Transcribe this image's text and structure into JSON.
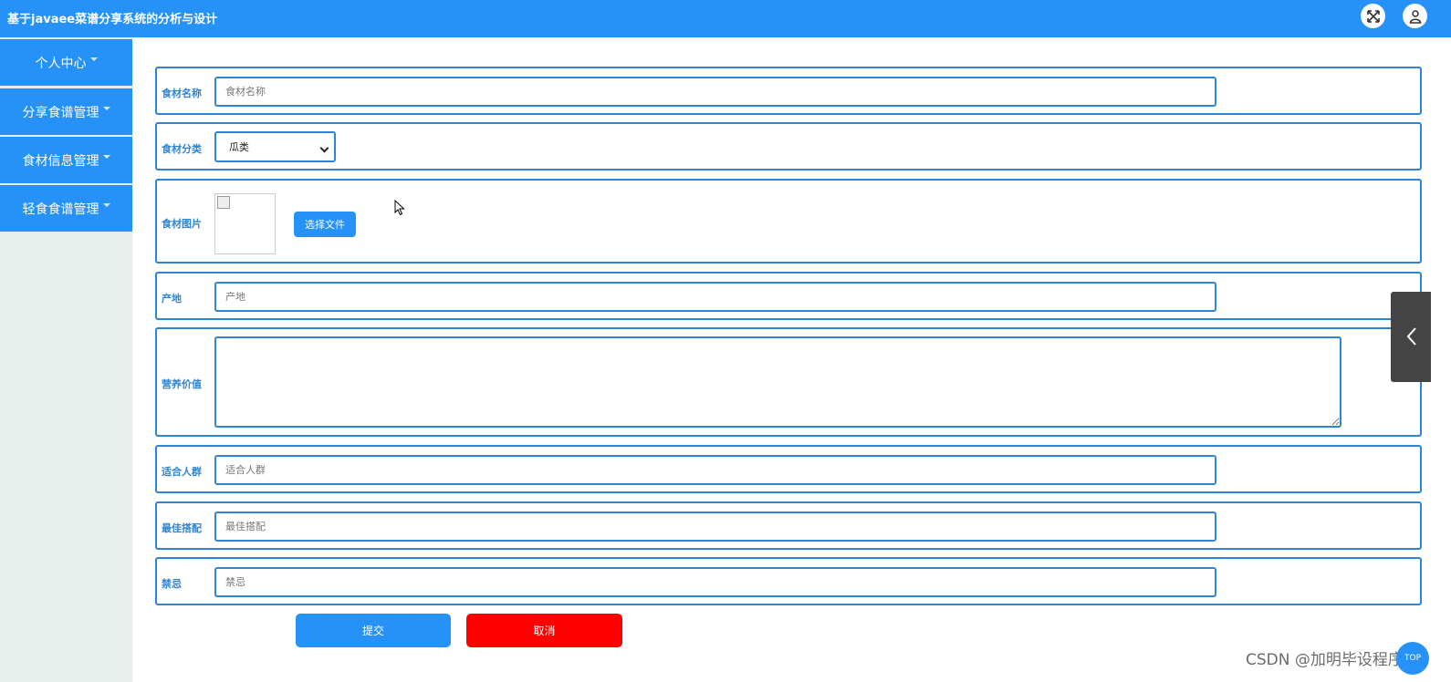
{
  "header": {
    "title": "基于javaee菜谱分享系统的分析与设计",
    "fullscreen_icon": "fullscreen-icon",
    "user_icon": "user-icon"
  },
  "sidebar": {
    "items": [
      {
        "label": "个人中心"
      },
      {
        "label": "分享食谱管理"
      },
      {
        "label": "食材信息管理"
      },
      {
        "label": "轻食食谱管理"
      }
    ]
  },
  "form": {
    "name": {
      "label": "食材名称",
      "placeholder": "食材名称",
      "value": ""
    },
    "category": {
      "label": "食材分类",
      "value": "瓜类"
    },
    "image": {
      "label": "食材图片",
      "button": "选择文件"
    },
    "origin": {
      "label": "产地",
      "placeholder": "产地",
      "value": ""
    },
    "nutrition": {
      "label": "营养价值",
      "value": ""
    },
    "suitable": {
      "label": "适合人群",
      "placeholder": "适合人群",
      "value": ""
    },
    "pairing": {
      "label": "最佳搭配",
      "placeholder": "最佳搭配",
      "value": ""
    },
    "taboo": {
      "label": "禁忌",
      "placeholder": "禁忌",
      "value": ""
    },
    "submit_label": "提交",
    "cancel_label": "取消"
  },
  "watermark": "CSDN @加明毕设程序",
  "back_to_top_label": "TOP",
  "colors": {
    "brand": "#2691f7",
    "border": "#2f84d3",
    "cancel": "#ff0000",
    "sidebar_bg": "#e6efec"
  }
}
